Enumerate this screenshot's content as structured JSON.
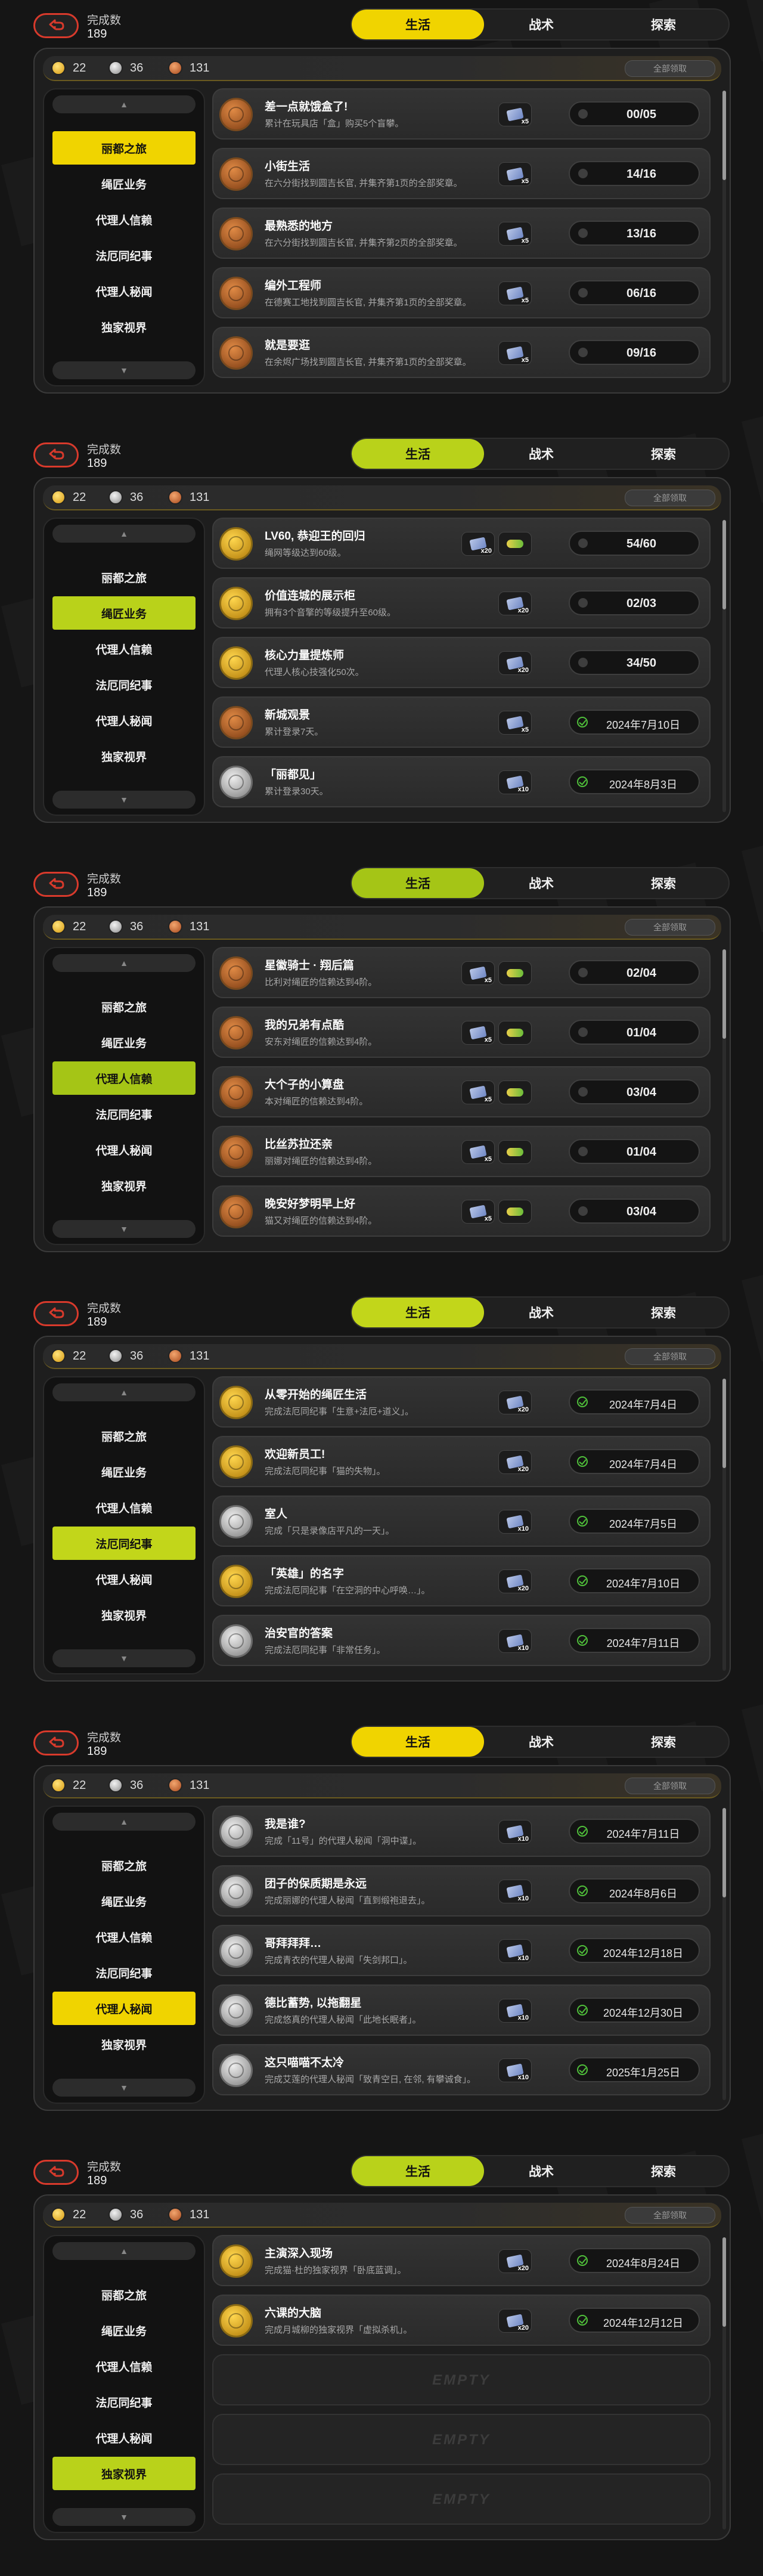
{
  "theme": {
    "tab_active_colors": [
      "#f0d400",
      "#b9d21a",
      "#a5c516",
      "#c2d61a",
      "#f0d400",
      "#b9d21a"
    ],
    "sidebar_active_colors": [
      "#f0d400",
      "#b9d21a",
      "#a5c516",
      "#c2d61a",
      "#f0d400",
      "#b9d21a"
    ]
  },
  "panels": [
    {
      "completion_label": "完成数",
      "completion_value": "189",
      "tabs": [
        "生活",
        "战术",
        "探索"
      ],
      "active_tab": 0,
      "currency": [
        "22",
        "36",
        "131"
      ],
      "claim_all": "全部领取",
      "sidebar": [
        "丽都之旅",
        "绳匠业务",
        "代理人信赖",
        "法厄同纪事",
        "代理人秘闻",
        "独家视界"
      ],
      "active_sidebar": 0,
      "rows": [
        {
          "title": "差一点就饿盒了!",
          "desc": "累计在玩具店「盒」购买5个盲攀。",
          "badge": "bronze",
          "rewards": [
            {
              "kind": "ticket",
              "qty": "x5"
            }
          ],
          "progress": "00/05",
          "done": false
        },
        {
          "title": "小街生活",
          "desc": "在六分街找到圆吉长官, 并集齐第1页的全部奖章。",
          "badge": "bronze",
          "rewards": [
            {
              "kind": "ticket",
              "qty": "x5"
            }
          ],
          "progress": "14/16",
          "done": false
        },
        {
          "title": "最熟悉的地方",
          "desc": "在六分街找到圆吉长官, 并集齐第2页的全部奖章。",
          "badge": "bronze",
          "rewards": [
            {
              "kind": "ticket",
              "qty": "x5"
            }
          ],
          "progress": "13/16",
          "done": false
        },
        {
          "title": "编外工程师",
          "desc": "在德赛工地找到圆吉长官, 并集齐第1页的全部奖章。",
          "badge": "bronze",
          "rewards": [
            {
              "kind": "ticket",
              "qty": "x5"
            }
          ],
          "progress": "06/16",
          "done": false
        },
        {
          "title": "就是要逛",
          "desc": "在余烬广场找到圆吉长官, 并集齐第1页的全部奖章。",
          "badge": "bronze",
          "rewards": [
            {
              "kind": "ticket",
              "qty": "x5"
            }
          ],
          "progress": "09/16",
          "done": false
        }
      ]
    },
    {
      "completion_label": "完成数",
      "completion_value": "189",
      "tabs": [
        "生活",
        "战术",
        "探索"
      ],
      "active_tab": 0,
      "currency": [
        "22",
        "36",
        "131"
      ],
      "claim_all": "全部领取",
      "sidebar": [
        "丽都之旅",
        "绳匠业务",
        "代理人信赖",
        "法厄同纪事",
        "代理人秘闻",
        "独家视界"
      ],
      "active_sidebar": 1,
      "rows": [
        {
          "title": "LV60, 恭迎王的回归",
          "desc": "绳网等级达到60级。",
          "badge": "gold",
          "rewards": [
            {
              "kind": "ticket",
              "qty": "x20"
            },
            {
              "kind": "chip",
              "qty": ""
            }
          ],
          "progress": "54/60",
          "done": false
        },
        {
          "title": "价值连城的展示柜",
          "desc": "拥有3个音擎的等级提升至60级。",
          "badge": "gold",
          "rewards": [
            {
              "kind": "ticket",
              "qty": "x20"
            }
          ],
          "progress": "02/03",
          "done": false
        },
        {
          "title": "核心力量提炼师",
          "desc": "代理人核心技强化50次。",
          "badge": "gold",
          "rewards": [
            {
              "kind": "ticket",
              "qty": "x20"
            }
          ],
          "progress": "34/50",
          "done": false
        },
        {
          "title": "新城观景",
          "desc": "累计登录7天。",
          "badge": "bronze",
          "rewards": [
            {
              "kind": "ticket",
              "qty": "x5"
            }
          ],
          "progress": "2024年7月10日",
          "done": true
        },
        {
          "title": "「丽都见」",
          "desc": "累计登录30天。",
          "badge": "silver",
          "rewards": [
            {
              "kind": "ticket",
              "qty": "x10"
            }
          ],
          "progress": "2024年8月3日",
          "done": true
        }
      ]
    },
    {
      "completion_label": "完成数",
      "completion_value": "189",
      "tabs": [
        "生活",
        "战术",
        "探索"
      ],
      "active_tab": 0,
      "currency": [
        "22",
        "36",
        "131"
      ],
      "claim_all": "全部领取",
      "sidebar": [
        "丽都之旅",
        "绳匠业务",
        "代理人信赖",
        "法厄同纪事",
        "代理人秘闻",
        "独家视界"
      ],
      "active_sidebar": 2,
      "rows": [
        {
          "title": "星徽骑士 · 翔后篇",
          "desc": "比利对绳匠的信赖达到4阶。",
          "badge": "bronze",
          "rewards": [
            {
              "kind": "ticket",
              "qty": "x5"
            },
            {
              "kind": "chip",
              "qty": ""
            }
          ],
          "progress": "02/04",
          "done": false
        },
        {
          "title": "我的兄弟有点酷",
          "desc": "安东对绳匠的信赖达到4阶。",
          "badge": "bronze",
          "rewards": [
            {
              "kind": "ticket",
              "qty": "x5"
            },
            {
              "kind": "chip",
              "qty": ""
            }
          ],
          "progress": "01/04",
          "done": false
        },
        {
          "title": "大个子的小算盘",
          "desc": "本对绳匠的信赖达到4阶。",
          "badge": "bronze",
          "rewards": [
            {
              "kind": "ticket",
              "qty": "x5"
            },
            {
              "kind": "chip",
              "qty": ""
            }
          ],
          "progress": "03/04",
          "done": false
        },
        {
          "title": "比丝苏拉还亲",
          "desc": "丽娜对绳匠的信赖达到4阶。",
          "badge": "bronze",
          "rewards": [
            {
              "kind": "ticket",
              "qty": "x5"
            },
            {
              "kind": "chip",
              "qty": ""
            }
          ],
          "progress": "01/04",
          "done": false
        },
        {
          "title": "晚安好梦明早上好",
          "desc": "猫又对绳匠的信赖达到4阶。",
          "badge": "bronze",
          "rewards": [
            {
              "kind": "ticket",
              "qty": "x5"
            },
            {
              "kind": "chip",
              "qty": ""
            }
          ],
          "progress": "03/04",
          "done": false
        }
      ]
    },
    {
      "completion_label": "完成数",
      "completion_value": "189",
      "tabs": [
        "生活",
        "战术",
        "探索"
      ],
      "active_tab": 0,
      "currency": [
        "22",
        "36",
        "131"
      ],
      "claim_all": "全部领取",
      "sidebar": [
        "丽都之旅",
        "绳匠业务",
        "代理人信赖",
        "法厄同纪事",
        "代理人秘闻",
        "独家视界"
      ],
      "active_sidebar": 3,
      "rows": [
        {
          "title": "从零开始的绳匠生活",
          "desc": "完成法厄同纪事「生意+法厄+道义」。",
          "badge": "gold",
          "rewards": [
            {
              "kind": "ticket",
              "qty": "x20"
            }
          ],
          "progress": "2024年7月4日",
          "done": true
        },
        {
          "title": "欢迎新员工!",
          "desc": "完成法厄同纪事「猫的失物」。",
          "badge": "gold",
          "rewards": [
            {
              "kind": "ticket",
              "qty": "x20"
            }
          ],
          "progress": "2024年7月4日",
          "done": true
        },
        {
          "title": "室人",
          "desc": "完成「只是录像店平凡的一天」。",
          "badge": "silver",
          "rewards": [
            {
              "kind": "ticket",
              "qty": "x10"
            }
          ],
          "progress": "2024年7月5日",
          "done": true
        },
        {
          "title": "「英雄」的名字",
          "desc": "完成法厄同纪事「在空洞的中心呼唤…」。",
          "badge": "gold",
          "rewards": [
            {
              "kind": "ticket",
              "qty": "x20"
            }
          ],
          "progress": "2024年7月10日",
          "done": true
        },
        {
          "title": "治安官的答案",
          "desc": "完成法厄同纪事「非常任务」。",
          "badge": "silver",
          "rewards": [
            {
              "kind": "ticket",
              "qty": "x10"
            }
          ],
          "progress": "2024年7月11日",
          "done": true
        }
      ]
    },
    {
      "completion_label": "完成数",
      "completion_value": "189",
      "tabs": [
        "生活",
        "战术",
        "探索"
      ],
      "active_tab": 0,
      "currency": [
        "22",
        "36",
        "131"
      ],
      "claim_all": "全部领取",
      "sidebar": [
        "丽都之旅",
        "绳匠业务",
        "代理人信赖",
        "法厄同纪事",
        "代理人秘闻",
        "独家视界"
      ],
      "active_sidebar": 4,
      "rows": [
        {
          "title": "我是谁?",
          "desc": "完成「11号」的代理人秘闻「洞中谍」。",
          "badge": "silver",
          "rewards": [
            {
              "kind": "ticket",
              "qty": "x10"
            }
          ],
          "progress": "2024年7月11日",
          "done": true
        },
        {
          "title": "团子的保质期是永远",
          "desc": "完成丽娜的代理人秘闻「直到缎袍退去」。",
          "badge": "silver",
          "rewards": [
            {
              "kind": "ticket",
              "qty": "x10"
            }
          ],
          "progress": "2024年8月6日",
          "done": true
        },
        {
          "title": "哥拜拜拜…",
          "desc": "完成青衣的代理人秘闻「失剑邦口」。",
          "badge": "silver",
          "rewards": [
            {
              "kind": "ticket",
              "qty": "x10"
            }
          ],
          "progress": "2024年12月18日",
          "done": true
        },
        {
          "title": "德比蓄势, 以拖翻星",
          "desc": "完成悠真的代理人秘闻「此地长眠者」。",
          "badge": "silver",
          "rewards": [
            {
              "kind": "ticket",
              "qty": "x10"
            }
          ],
          "progress": "2024年12月30日",
          "done": true
        },
        {
          "title": "这只喵喵不太冷",
          "desc": "完成艾莲的代理人秘闻「致青空日, 在邻, 有攀诚食」。",
          "badge": "silver",
          "rewards": [
            {
              "kind": "ticket",
              "qty": "x10"
            }
          ],
          "progress": "2025年1月25日",
          "done": true
        }
      ]
    },
    {
      "completion_label": "完成数",
      "completion_value": "189",
      "tabs": [
        "生活",
        "战术",
        "探索"
      ],
      "active_tab": 0,
      "currency": [
        "22",
        "36",
        "131"
      ],
      "claim_all": "全部领取",
      "sidebar": [
        "丽都之旅",
        "绳匠业务",
        "代理人信赖",
        "法厄同纪事",
        "代理人秘闻",
        "独家视界"
      ],
      "active_sidebar": 5,
      "rows": [
        {
          "title": "主演深入现场",
          "desc": "完成猫·杜的独家视界「卧底蓝调」。",
          "badge": "gold",
          "rewards": [
            {
              "kind": "ticket",
              "qty": "x20"
            }
          ],
          "progress": "2024年8月24日",
          "done": true
        },
        {
          "title": "六课的大脑",
          "desc": "完成月城柳的独家视界「虚拟杀机」。",
          "badge": "gold",
          "rewards": [
            {
              "kind": "ticket",
              "qty": "x20"
            }
          ],
          "progress": "2024年12月12日",
          "done": true
        },
        {
          "empty": "EMPTY"
        },
        {
          "empty": "EMPTY"
        },
        {
          "empty": "EMPTY"
        }
      ]
    }
  ]
}
